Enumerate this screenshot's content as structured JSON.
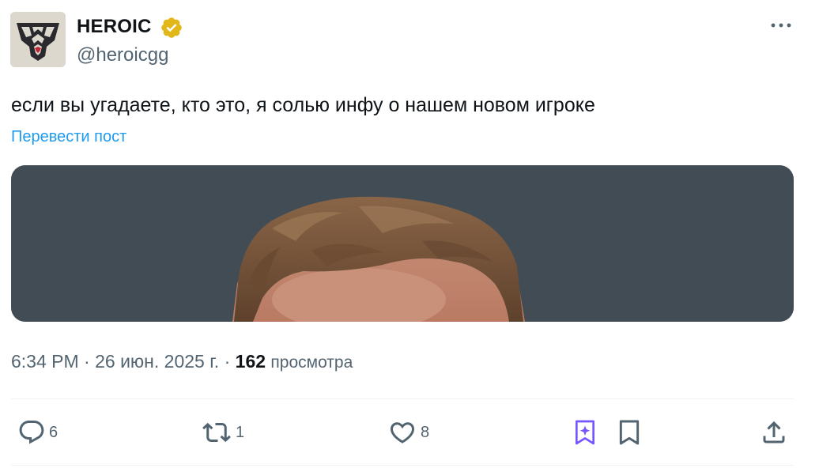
{
  "author": {
    "name": "HEROIC",
    "handle": "@heroicgg",
    "verified_color": "#e2b719",
    "avatar_icon": "heroic-logo-icon"
  },
  "post": {
    "text": "если вы угадаете, кто это, я солью инфу о нашем новом игроке",
    "translate_label": "Перевести пост",
    "image_description_icon": "photo-person-hair"
  },
  "meta": {
    "time": "6:34 PM",
    "separator": "·",
    "date": "26 июн. 2025 г.",
    "views_count": "162",
    "views_label": "просмотра"
  },
  "actions": {
    "reply_count": "6",
    "retweet_count": "1",
    "like_count": "8"
  },
  "colors": {
    "link": "#1d9bf0",
    "secondary_text": "#536471",
    "grok_accent": "#7856ff"
  }
}
